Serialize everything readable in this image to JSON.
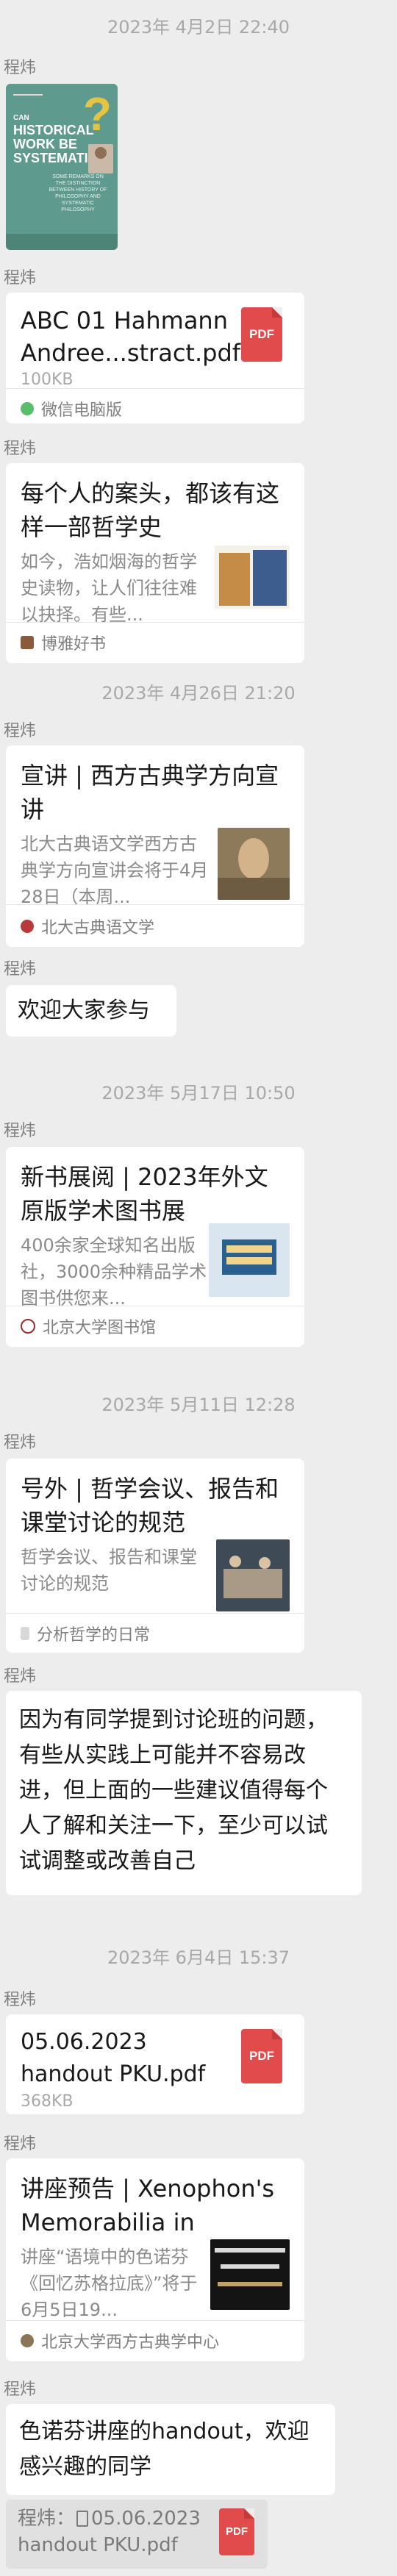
{
  "timestamps": [
    "2023年 4月2日 22:40",
    "2023年 4月26日 21:20",
    "2023年 5月17日 10:50",
    "2023年 5月11日 12:28",
    "2023年 6月4日 15:37"
  ],
  "sender": "程炜",
  "poster": {
    "title_lines": [
      "CAN",
      "HISTORICAL",
      "WORK BE",
      "SYSTEMATIC"
    ],
    "sub": "SOME REMARKS ON THE DISTINCTION BETWEEN HISTORY OF PHILOSOPHY AND SYSTEMATIC PHILOSOPHY"
  },
  "file1": {
    "name": "ABC 01 Hahmann Andree...stract.pdf",
    "size": "100KB",
    "source": "微信电脑版",
    "icon_label": "PDF"
  },
  "article1": {
    "title": "每个人的案头，都该有这样一部哲学史",
    "desc": "如今，浩如烟海的哲学史读物，让人们往往难以抉择。有些...",
    "source": "博雅好书"
  },
  "article2": {
    "title": "宣讲 | 西方古典学方向宣讲",
    "desc": "北大古典语文学西方古典学方向宣讲会将于4月28日（本周...",
    "source": "北大古典语文学"
  },
  "msg1": "欢迎大家参与",
  "article3": {
    "title": "新书展阅 | 2023年外文原版学术图书展",
    "desc": "400余家全球知名出版社，3000余种精品学术图书供您来...",
    "source": "北京大学图书馆"
  },
  "article4": {
    "title": "号外 | 哲学会议、报告和课堂讨论的规范",
    "desc": "哲学会议、报告和课堂讨论的规范",
    "source": "分析哲学的日常"
  },
  "msg2": "因为有同学提到讨论班的问题，有些从实践上可能并不容易改进，但上面的一些建议值得每个人了解和关注一下，至少可以试试调整或改善自己",
  "file2": {
    "name": "05.06.2023 handout PKU.pdf",
    "size": "368KB",
    "icon_label": "PDF"
  },
  "article5": {
    "title": "讲座预告 | Xenophon's Memorabilia in Context ...",
    "desc": "讲座“语境中的色诺芬《回忆苏格拉底》”将于6月5日19...",
    "source": "北京大学西方古典学中心"
  },
  "msg3": "色诺芬讲座的handout，欢迎感兴趣的同学",
  "quote": {
    "prefix": "程炜：",
    "file_name": "05.06.2023 handout PKU.pdf",
    "icon_label": "PDF"
  }
}
